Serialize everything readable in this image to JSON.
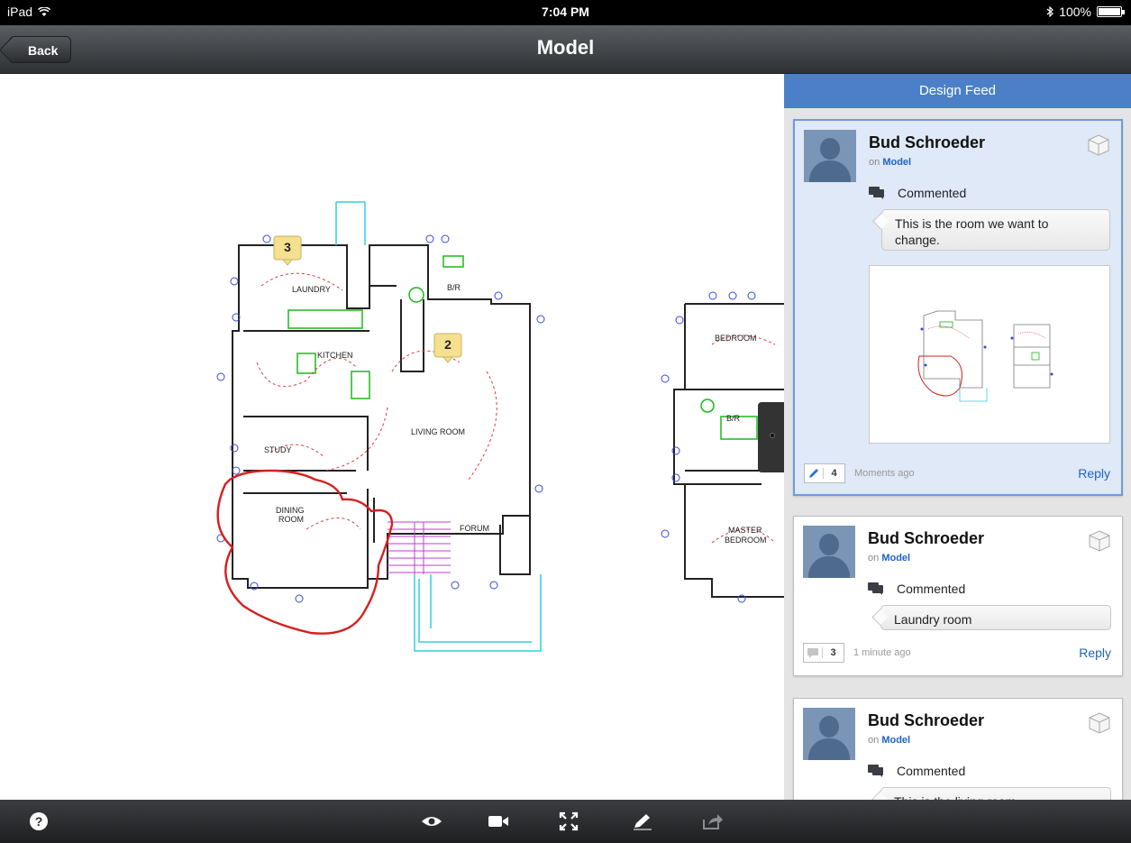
{
  "statusbar": {
    "device": "iPad",
    "time": "7:04 PM",
    "battery": "100%"
  },
  "navbar": {
    "back_label": "Back",
    "title": "Model"
  },
  "canvas": {
    "markers": [
      {
        "label": "3"
      },
      {
        "label": "2"
      }
    ],
    "rooms": [
      "LAUNDRY",
      "KITCHEN",
      "B/R",
      "LIVING ROOM",
      "STUDY",
      "DINING ROOM",
      "FORUM",
      "BEDROOM",
      "MASTER BEDROOM"
    ]
  },
  "feed": {
    "header": "Design Feed",
    "cards": [
      {
        "author": "Bud Schroeder",
        "on": "on",
        "target": "Model",
        "action": "Commented",
        "comment": "This is the room we want to change.",
        "count": "4",
        "time": "Moments ago",
        "reply": "Reply"
      },
      {
        "author": "Bud Schroeder",
        "on": "on",
        "target": "Model",
        "action": "Commented",
        "comment": "Laundry room",
        "count": "3",
        "time": "1 minute ago",
        "reply": "Reply"
      },
      {
        "author": "Bud Schroeder",
        "on": "on",
        "target": "Model",
        "action": "Commented",
        "comment": "This is the living room"
      }
    ]
  },
  "toolbar": {
    "icons": [
      "help-icon",
      "eye-icon",
      "camera-icon",
      "fullscreen-icon",
      "markup-icon",
      "share-icon"
    ]
  },
  "colors": {
    "accent": "#4b80c8",
    "link": "#1c63c9",
    "markup": "#d61f1f"
  }
}
